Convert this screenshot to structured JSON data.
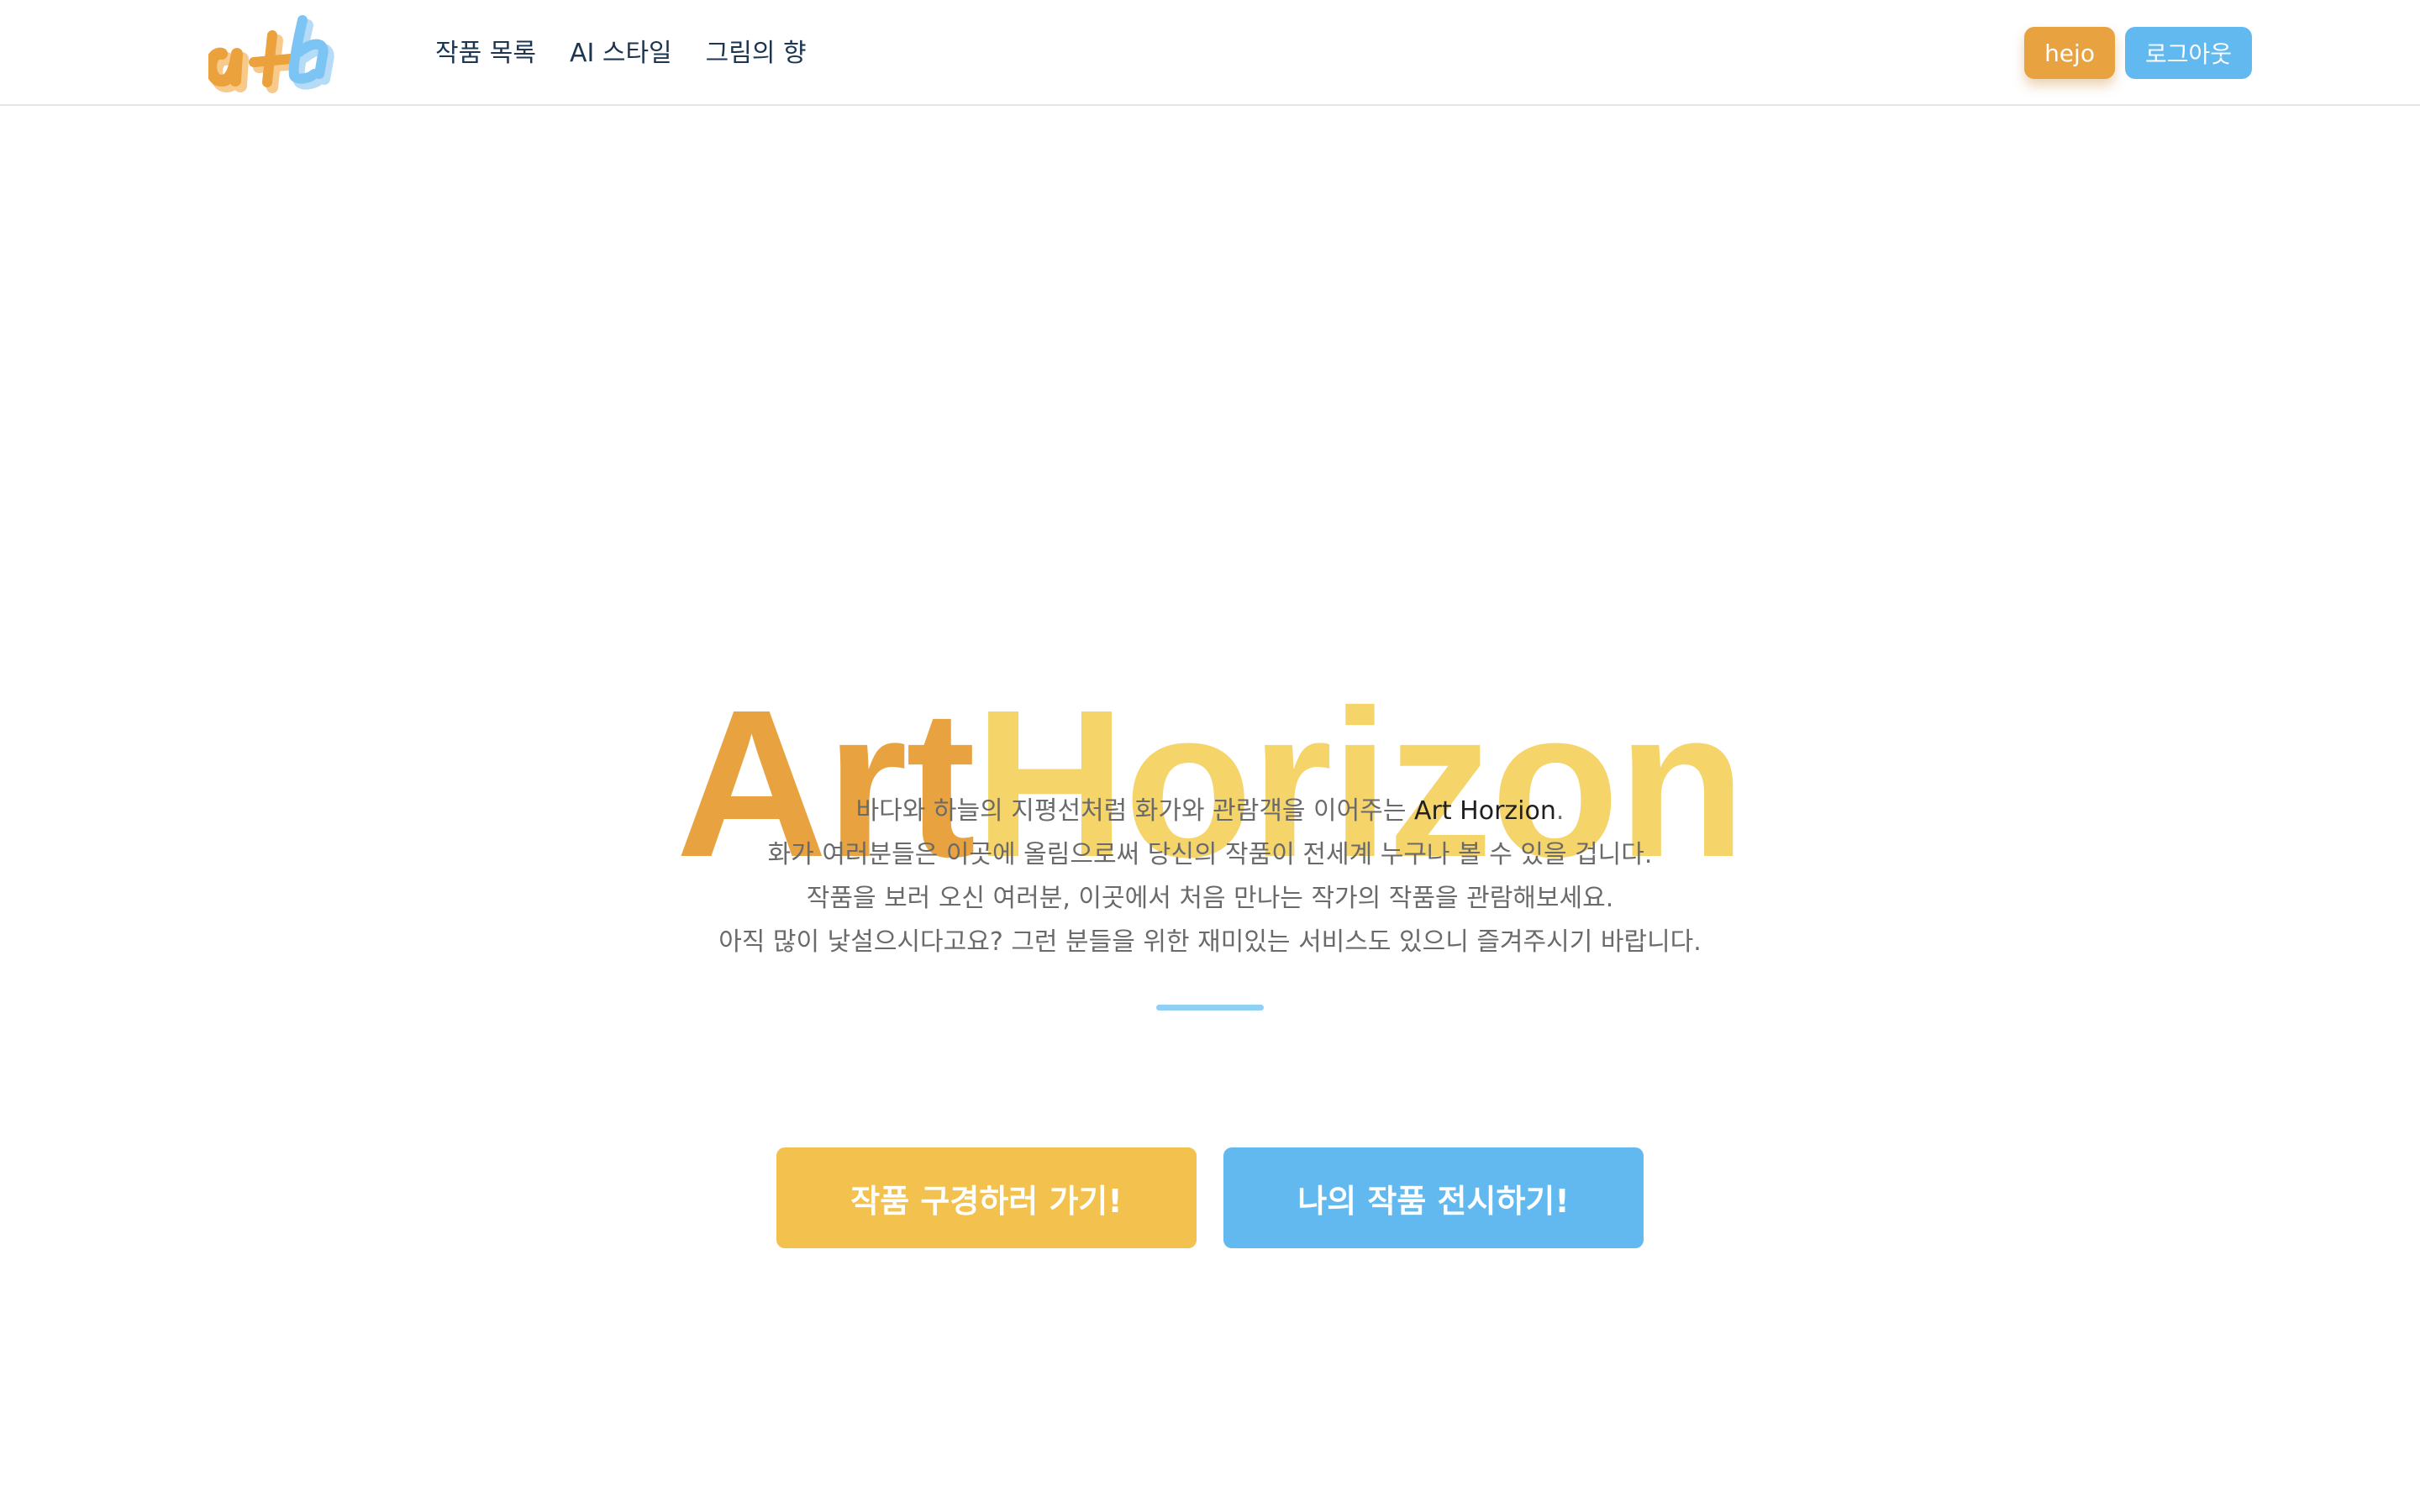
{
  "navbar": {
    "logo_text": "aH",
    "links": [
      {
        "label": "작품 목록"
      },
      {
        "label": "AI 스타일"
      },
      {
        "label": "그림의 향"
      }
    ],
    "user_label": "hejo",
    "logout_label": "로그아웃"
  },
  "hero": {
    "title_part1": "Art",
    "title_part2": "Horizon",
    "intro": {
      "line1_prefix": "바다와 하늘의 지평선처럼 화가와 관람객을 이어주는 ",
      "line1_brand": "Art Horzion",
      "line1_suffix": ".",
      "line2": "화가 여러분들은 이곳에 올림으로써 당신의 작품이 전세계 누구나 볼 수 있을 겁니다.",
      "line3": "작품을 보러 오신 여러분, 이곳에서 처음 만나는 작가의 작품을 관람해보세요.",
      "line4": "아직 많이 낯설으시다고요? 그런 분들을 위한 재미있는 서비스도 있으니 즐겨주시기 바랍니다."
    },
    "cta_browse": "작품 구경하러 가기!",
    "cta_exhibit": "나의 작품 전시하기!"
  },
  "colors": {
    "orange": "#e8a23f",
    "yellow": "#f5d46a",
    "button_yellow": "#f2c14e",
    "blue": "#62b9f0",
    "light_blue": "#8fd0f5",
    "nav_text": "#1c3550"
  }
}
